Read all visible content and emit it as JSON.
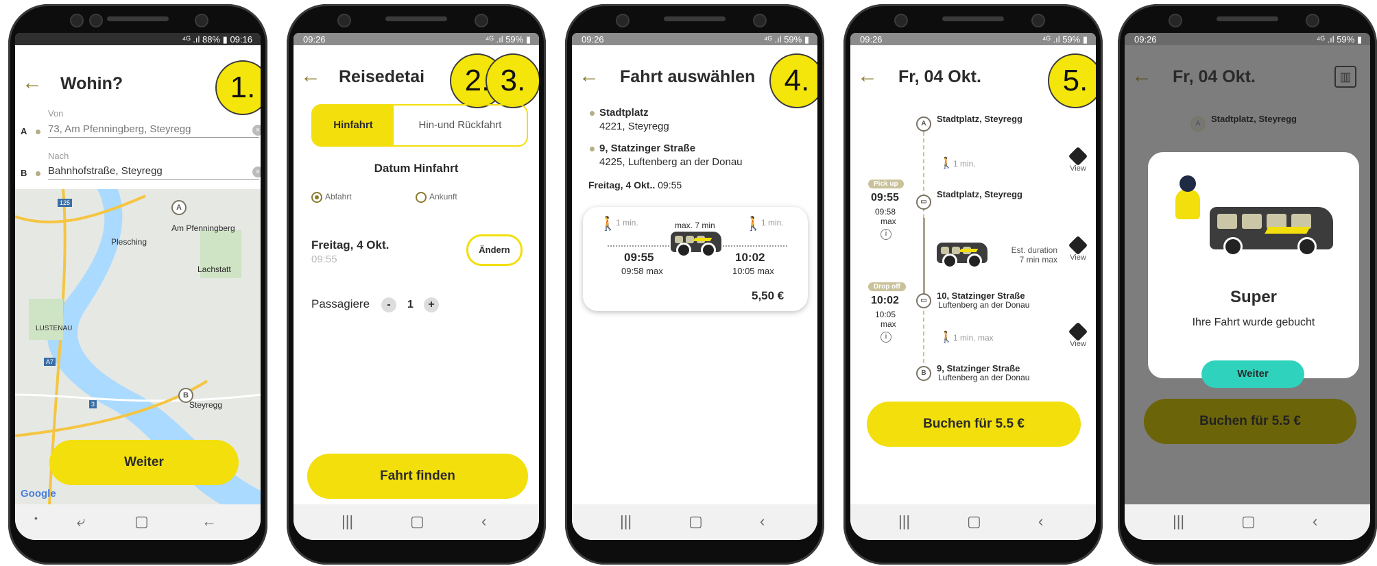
{
  "colors": {
    "accent": "#f2df0c",
    "olive": "#8a7a2e",
    "teal": "#2fd3bd"
  },
  "screens": [
    {
      "status": {
        "time": "09:16",
        "battery": "88%"
      },
      "title": "Wohin?",
      "step": "1.",
      "from": {
        "label": "Von",
        "value": "73, Am Pfenningberg, Steyregg",
        "marker": "A"
      },
      "to": {
        "label": "Nach",
        "value": "Bahnhofstraße, Steyregg",
        "marker": "B"
      },
      "map_labels": [
        "Am Pfenningberg",
        "Plesching",
        "Lachstatt",
        "LUSTENAU",
        "Steyregg",
        "125",
        "A7",
        "3"
      ],
      "map_pins": [
        "A",
        "B"
      ],
      "map_logo": "Google",
      "button": "Weiter"
    },
    {
      "status": {
        "time": "09:26",
        "battery": "59%"
      },
      "title": "Reisedetai",
      "steps": [
        "2.",
        "3."
      ],
      "tabs": [
        "Hinfahrt",
        "Hin-und Rückfahrt"
      ],
      "date_header": "Datum Hinfahrt",
      "radio": [
        "Abfahrt",
        "Ankunft"
      ],
      "date": "Freitag, 4 Okt.",
      "time": "09:55",
      "change": "Ändern",
      "passengers_label": "Passagiere",
      "minus": "-",
      "count": "1",
      "plus": "+",
      "button": "Fahrt finden"
    },
    {
      "status": {
        "time": "09:26",
        "battery": "59%"
      },
      "title": "Fahrt auswählen",
      "step": "4.",
      "from_name": "Stadtplatz",
      "from_addr": "4221, Steyregg",
      "to_name": "9, Statzinger Straße",
      "to_addr": "4225, Luftenberg an der Donau",
      "date_prefix": "Freitag, 4 Okt..",
      "date_time": "09:55",
      "walk1": "1 min.",
      "ride_max": "max.  7 min",
      "walk2": "1 min.",
      "dep": "09:55",
      "dep_max": "09:58 max",
      "arr": "10:02",
      "arr_max": "10:05 max",
      "price": "5,50 €"
    },
    {
      "status": {
        "time": "09:26",
        "battery": "59%"
      },
      "title": "Fr, 04 Okt.",
      "step": "5.",
      "stop_a": "Stadtplatz, Steyregg",
      "walk_a": "1 min.",
      "pickup_badge": "Pick up",
      "pickup_time": "09:55",
      "pickup_max_time": "09:58",
      "pickup_max": "max",
      "pickup_stop": "Stadtplatz, Steyregg",
      "est": "Est. duration",
      "est_val": "7 min max",
      "dropoff_badge": "Drop off",
      "drop_time": "10:02",
      "drop_max_time": "10:05",
      "drop_max": "max",
      "drop_stop": "10, Statzinger Straße",
      "drop_city": "Luftenberg an der Donau",
      "walk_b": "1 min. max",
      "stop_b": "9, Statzinger Straße",
      "stop_b_city": "Luftenberg an der Donau",
      "view": "View",
      "button": "Buchen für 5.5 €"
    },
    {
      "status": {
        "time": "09:26",
        "battery": "59%"
      },
      "title": "Fr, 04 Okt.",
      "stop_a": "Stadtplatz, Steyregg",
      "modal_title": "Super",
      "modal_text": "Ihre Fahrt wurde gebucht",
      "modal_button": "Weiter",
      "button": "Buchen für 5.5 €"
    }
  ]
}
